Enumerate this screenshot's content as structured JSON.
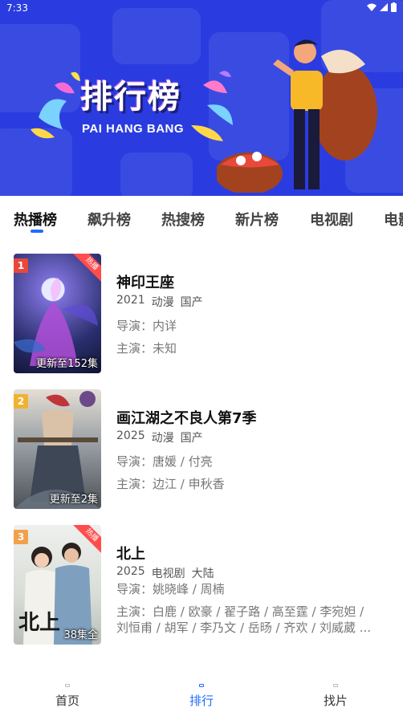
{
  "status_bar": {
    "time": "7:33"
  },
  "banner": {
    "title": "排行榜",
    "subtitle": "PAI HANG BANG"
  },
  "tabs": [
    {
      "label": "热播榜",
      "active": true
    },
    {
      "label": "飙升榜",
      "active": false
    },
    {
      "label": "热搜榜",
      "active": false
    },
    {
      "label": "新片榜",
      "active": false
    },
    {
      "label": "电视剧",
      "active": false
    },
    {
      "label": "电影",
      "active": false
    }
  ],
  "items": [
    {
      "rank": "1",
      "rank_color": "#e8483b",
      "hot_tag": "热播",
      "poster_caption": "更新至152集",
      "title": "神印王座",
      "year": "2021",
      "genre": "动漫",
      "region": "国产",
      "director_line": "导演：内详",
      "cast_line_1": "主演：未知",
      "cast_line_2": ""
    },
    {
      "rank": "2",
      "rank_color": "#f0b230",
      "hot_tag": "",
      "poster_caption": "更新至2集",
      "title": "画江湖之不良人第7季",
      "year": "2025",
      "genre": "动漫",
      "region": "国产",
      "director_line": "导演：唐媛 / 付亮",
      "cast_line_1": "主演：边江 / 申秋香",
      "cast_line_2": ""
    },
    {
      "rank": "3",
      "rank_color": "#f2a14a",
      "hot_tag": "热播",
      "poster_caption": "38集全",
      "title": "北上",
      "year": "2025",
      "genre": "电视剧",
      "region": "大陆",
      "director_line": "导演：姚晓峰 / 周楠",
      "cast_line_1": "主演：白鹿 / 欧豪 / 翟子路 / 高至霆 / 李宛妲 /",
      "cast_line_2": "刘恒甫 / 胡军 / 李乃文 / 岳旸 / 齐欢 / 刘威葳 ..."
    }
  ],
  "bottom_nav": [
    {
      "label": "首页",
      "active": false
    },
    {
      "label": "排行",
      "active": true
    },
    {
      "label": "找片",
      "active": false
    }
  ],
  "colors": {
    "banner_bg": "#2a3ce0",
    "accent": "#1e6cff",
    "hot_tag": "#ff4d4d"
  }
}
